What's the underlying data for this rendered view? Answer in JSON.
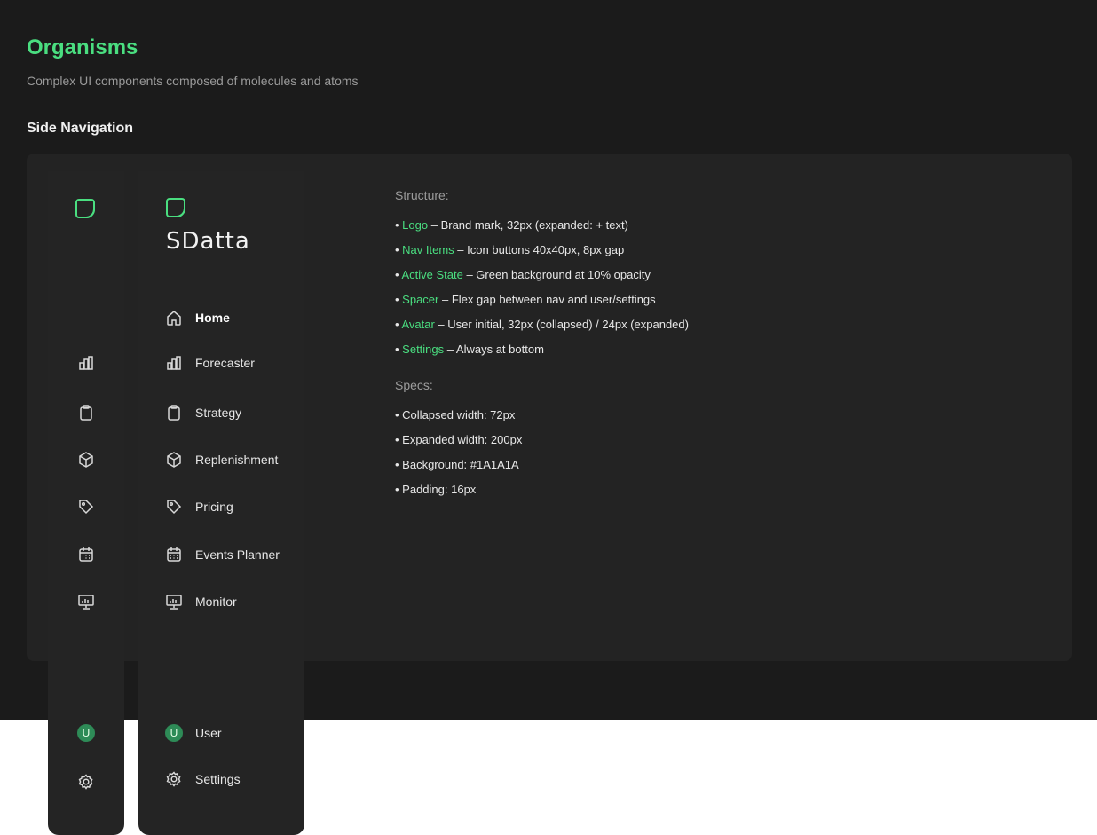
{
  "page": {
    "title": "Organisms",
    "subtitle": "Complex UI components composed of molecules and atoms",
    "section_title": "Side Navigation"
  },
  "brand": {
    "text": "SDatta",
    "accent_color": "#4ade80"
  },
  "nav": {
    "items": [
      {
        "label": "Home",
        "icon": "home-icon",
        "active": true
      },
      {
        "label": "Forecaster",
        "icon": "bar-chart-icon"
      },
      {
        "label": "Strategy",
        "icon": "clipboard-icon"
      },
      {
        "label": "Replenishment",
        "icon": "box-icon"
      },
      {
        "label": "Pricing",
        "icon": "tag-icon"
      },
      {
        "label": "Events Planner",
        "icon": "calendar-icon"
      },
      {
        "label": "Monitor",
        "icon": "monitor-icon"
      }
    ],
    "user": {
      "label": "User",
      "initial": "U"
    },
    "settings": {
      "label": "Settings",
      "icon": "gear-icon"
    }
  },
  "structure": {
    "heading": "Structure:",
    "items": [
      {
        "term": "Logo",
        "desc": "Brand mark, 32px (expanded: + text)"
      },
      {
        "term": "Nav Items",
        "desc": "Icon buttons 40x40px, 8px gap"
      },
      {
        "term": "Active State",
        "desc": "Green background at 10% opacity"
      },
      {
        "term": "Spacer",
        "desc": "Flex gap between nav and user/settings"
      },
      {
        "term": "Avatar",
        "desc": "User initial, 32px (collapsed) / 24px (expanded)"
      },
      {
        "term": "Settings",
        "desc": "Always at bottom"
      }
    ]
  },
  "specs": {
    "heading": "Specs:",
    "items": [
      "Collapsed width: 72px",
      "Expanded width: 200px",
      "Background: #1A1A1A",
      "Padding: 16px"
    ]
  }
}
